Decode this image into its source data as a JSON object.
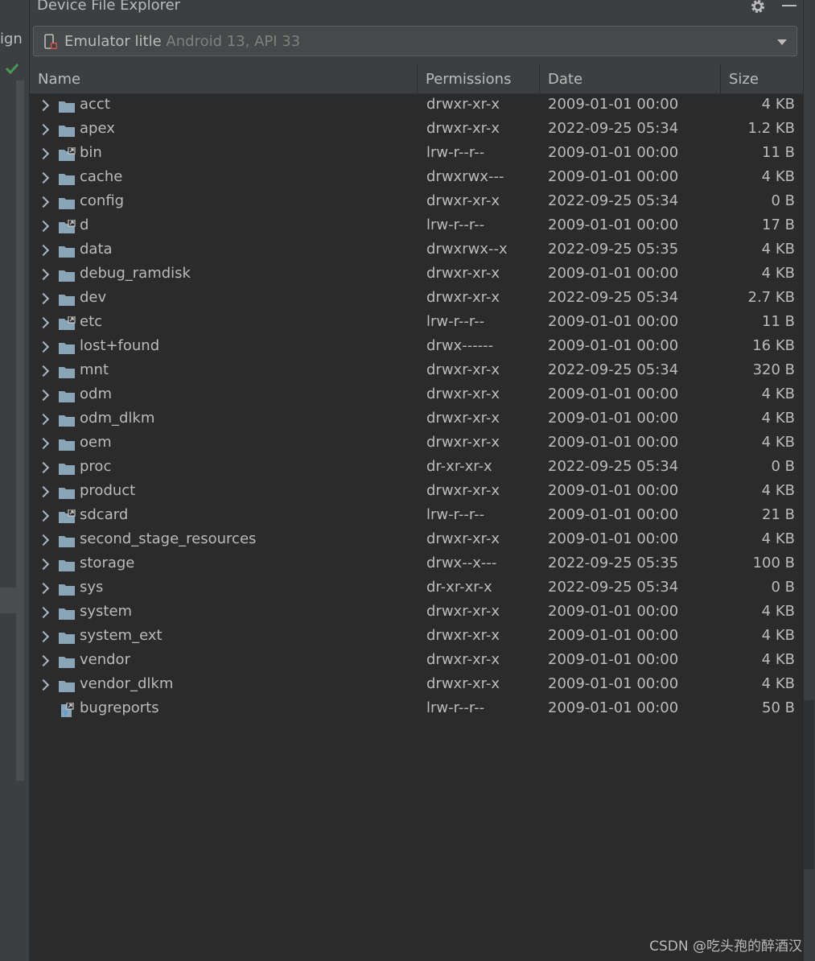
{
  "left_strip": {
    "tab_text": "ign"
  },
  "panel": {
    "title": "Device File Explorer",
    "device_name": "Emulator litle",
    "device_detail": "Android 13, API 33"
  },
  "columns": {
    "name": "Name",
    "permissions": "Permissions",
    "date": "Date",
    "size": "Size"
  },
  "files": [
    {
      "name": "acct",
      "perm": "drwxr-xr-x",
      "date": "2009-01-01 00:00",
      "size": "4 KB",
      "icon": "folder-icon",
      "expandable": true
    },
    {
      "name": "apex",
      "perm": "drwxr-xr-x",
      "date": "2022-09-25 05:34",
      "size": "1.2 KB",
      "icon": "folder-icon",
      "expandable": true
    },
    {
      "name": "bin",
      "perm": "lrw-r--r--",
      "date": "2009-01-01 00:00",
      "size": "11 B",
      "icon": "folder-link-icon",
      "expandable": true
    },
    {
      "name": "cache",
      "perm": "drwxrwx---",
      "date": "2009-01-01 00:00",
      "size": "4 KB",
      "icon": "folder-icon",
      "expandable": true
    },
    {
      "name": "config",
      "perm": "drwxr-xr-x",
      "date": "2022-09-25 05:34",
      "size": "0 B",
      "icon": "folder-icon",
      "expandable": true
    },
    {
      "name": "d",
      "perm": "lrw-r--r--",
      "date": "2009-01-01 00:00",
      "size": "17 B",
      "icon": "folder-link-icon",
      "expandable": true
    },
    {
      "name": "data",
      "perm": "drwxrwx--x",
      "date": "2022-09-25 05:35",
      "size": "4 KB",
      "icon": "folder-icon",
      "expandable": true
    },
    {
      "name": "debug_ramdisk",
      "perm": "drwxr-xr-x",
      "date": "2009-01-01 00:00",
      "size": "4 KB",
      "icon": "folder-icon",
      "expandable": true
    },
    {
      "name": "dev",
      "perm": "drwxr-xr-x",
      "date": "2022-09-25 05:34",
      "size": "2.7 KB",
      "icon": "folder-icon",
      "expandable": true
    },
    {
      "name": "etc",
      "perm": "lrw-r--r--",
      "date": "2009-01-01 00:00",
      "size": "11 B",
      "icon": "folder-link-icon",
      "expandable": true
    },
    {
      "name": "lost+found",
      "perm": "drwx------",
      "date": "2009-01-01 00:00",
      "size": "16 KB",
      "icon": "folder-icon",
      "expandable": true
    },
    {
      "name": "mnt",
      "perm": "drwxr-xr-x",
      "date": "2022-09-25 05:34",
      "size": "320 B",
      "icon": "folder-icon",
      "expandable": true
    },
    {
      "name": "odm",
      "perm": "drwxr-xr-x",
      "date": "2009-01-01 00:00",
      "size": "4 KB",
      "icon": "folder-icon",
      "expandable": true
    },
    {
      "name": "odm_dlkm",
      "perm": "drwxr-xr-x",
      "date": "2009-01-01 00:00",
      "size": "4 KB",
      "icon": "folder-icon",
      "expandable": true
    },
    {
      "name": "oem",
      "perm": "drwxr-xr-x",
      "date": "2009-01-01 00:00",
      "size": "4 KB",
      "icon": "folder-icon",
      "expandable": true
    },
    {
      "name": "proc",
      "perm": "dr-xr-xr-x",
      "date": "2022-09-25 05:34",
      "size": "0 B",
      "icon": "folder-icon",
      "expandable": true
    },
    {
      "name": "product",
      "perm": "drwxr-xr-x",
      "date": "2009-01-01 00:00",
      "size": "4 KB",
      "icon": "folder-icon",
      "expandable": true
    },
    {
      "name": "sdcard",
      "perm": "lrw-r--r--",
      "date": "2009-01-01 00:00",
      "size": "21 B",
      "icon": "folder-link-icon",
      "expandable": true
    },
    {
      "name": "second_stage_resources",
      "perm": "drwxr-xr-x",
      "date": "2009-01-01 00:00",
      "size": "4 KB",
      "icon": "folder-icon",
      "expandable": true
    },
    {
      "name": "storage",
      "perm": "drwx--x---",
      "date": "2022-09-25 05:35",
      "size": "100 B",
      "icon": "folder-icon",
      "expandable": true
    },
    {
      "name": "sys",
      "perm": "dr-xr-xr-x",
      "date": "2022-09-25 05:34",
      "size": "0 B",
      "icon": "folder-icon",
      "expandable": true
    },
    {
      "name": "system",
      "perm": "drwxr-xr-x",
      "date": "2009-01-01 00:00",
      "size": "4 KB",
      "icon": "folder-icon",
      "expandable": true
    },
    {
      "name": "system_ext",
      "perm": "drwxr-xr-x",
      "date": "2009-01-01 00:00",
      "size": "4 KB",
      "icon": "folder-icon",
      "expandable": true
    },
    {
      "name": "vendor",
      "perm": "drwxr-xr-x",
      "date": "2009-01-01 00:00",
      "size": "4 KB",
      "icon": "folder-icon",
      "expandable": true
    },
    {
      "name": "vendor_dlkm",
      "perm": "drwxr-xr-x",
      "date": "2009-01-01 00:00",
      "size": "4 KB",
      "icon": "folder-icon",
      "expandable": true
    },
    {
      "name": "bugreports",
      "perm": "lrw-r--r--",
      "date": "2009-01-01 00:00",
      "size": "50 B",
      "icon": "unknown-link-icon",
      "expandable": false
    }
  ],
  "watermark": "CSDN @吃头孢的醉酒汉",
  "colors": {
    "background": "#3c3f41",
    "table": "#2b2b2b",
    "text": "#bbbbbb",
    "folder": "#8aa4b8",
    "check": "#499c54"
  }
}
